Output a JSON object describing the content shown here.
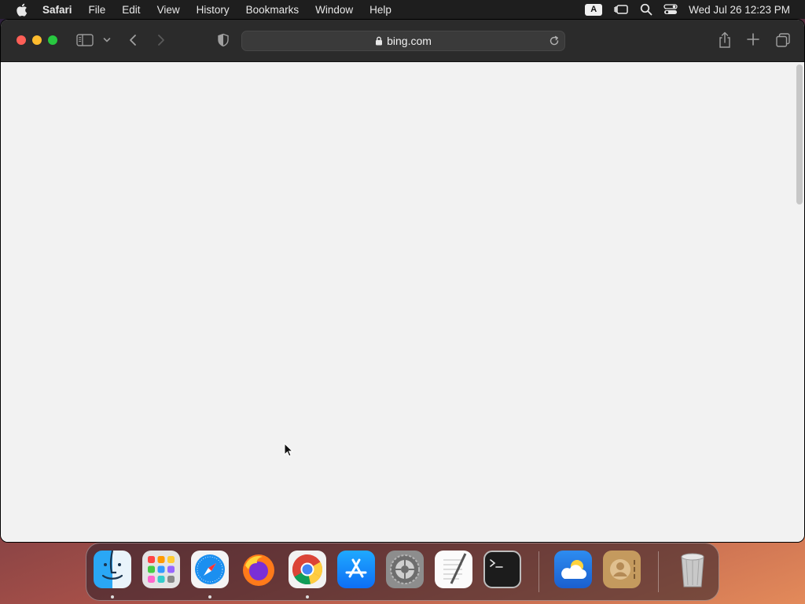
{
  "menubar": {
    "app_name": "Safari",
    "items": [
      "File",
      "Edit",
      "View",
      "History",
      "Bookmarks",
      "Window",
      "Help"
    ],
    "input_indicator": "A",
    "clock": "Wed Jul 26  12:23 PM"
  },
  "toolbar": {
    "url": "bing.com"
  },
  "dock": {
    "apps": [
      "finder",
      "launchpad",
      "safari",
      "firefox",
      "chrome",
      "app-store",
      "system-settings",
      "textedit",
      "terminal",
      "weather",
      "contacts",
      "trash"
    ]
  }
}
